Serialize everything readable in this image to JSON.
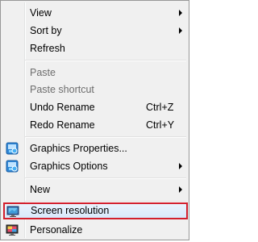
{
  "context_menu": {
    "items": [
      {
        "id": "view",
        "label": "View",
        "submenu": true
      },
      {
        "id": "sort_by",
        "label": "Sort by",
        "submenu": true
      },
      {
        "id": "refresh",
        "label": "Refresh"
      },
      {
        "id": "paste",
        "label": "Paste",
        "disabled": true
      },
      {
        "id": "paste_shortcut",
        "label": "Paste shortcut",
        "disabled": true
      },
      {
        "id": "undo_rename",
        "label": "Undo Rename",
        "shortcut": "Ctrl+Z"
      },
      {
        "id": "redo_rename",
        "label": "Redo Rename",
        "shortcut": "Ctrl+Y"
      },
      {
        "id": "graphics_properties",
        "label": "Graphics Properties...",
        "icon": "intel-graphics-icon"
      },
      {
        "id": "graphics_options",
        "label": "Graphics Options",
        "submenu": true,
        "icon": "intel-graphics-icon"
      },
      {
        "id": "new",
        "label": "New",
        "submenu": true
      },
      {
        "id": "screen_resolution",
        "label": "Screen resolution",
        "icon": "monitor-icon",
        "highlighted": true
      },
      {
        "id": "personalize",
        "label": "Personalize",
        "icon": "personalize-icon"
      }
    ]
  },
  "colors": {
    "menu_background": "#f0f0f0",
    "highlight_outline": "#d21f2d",
    "disabled_text": "#6d6d6d"
  }
}
